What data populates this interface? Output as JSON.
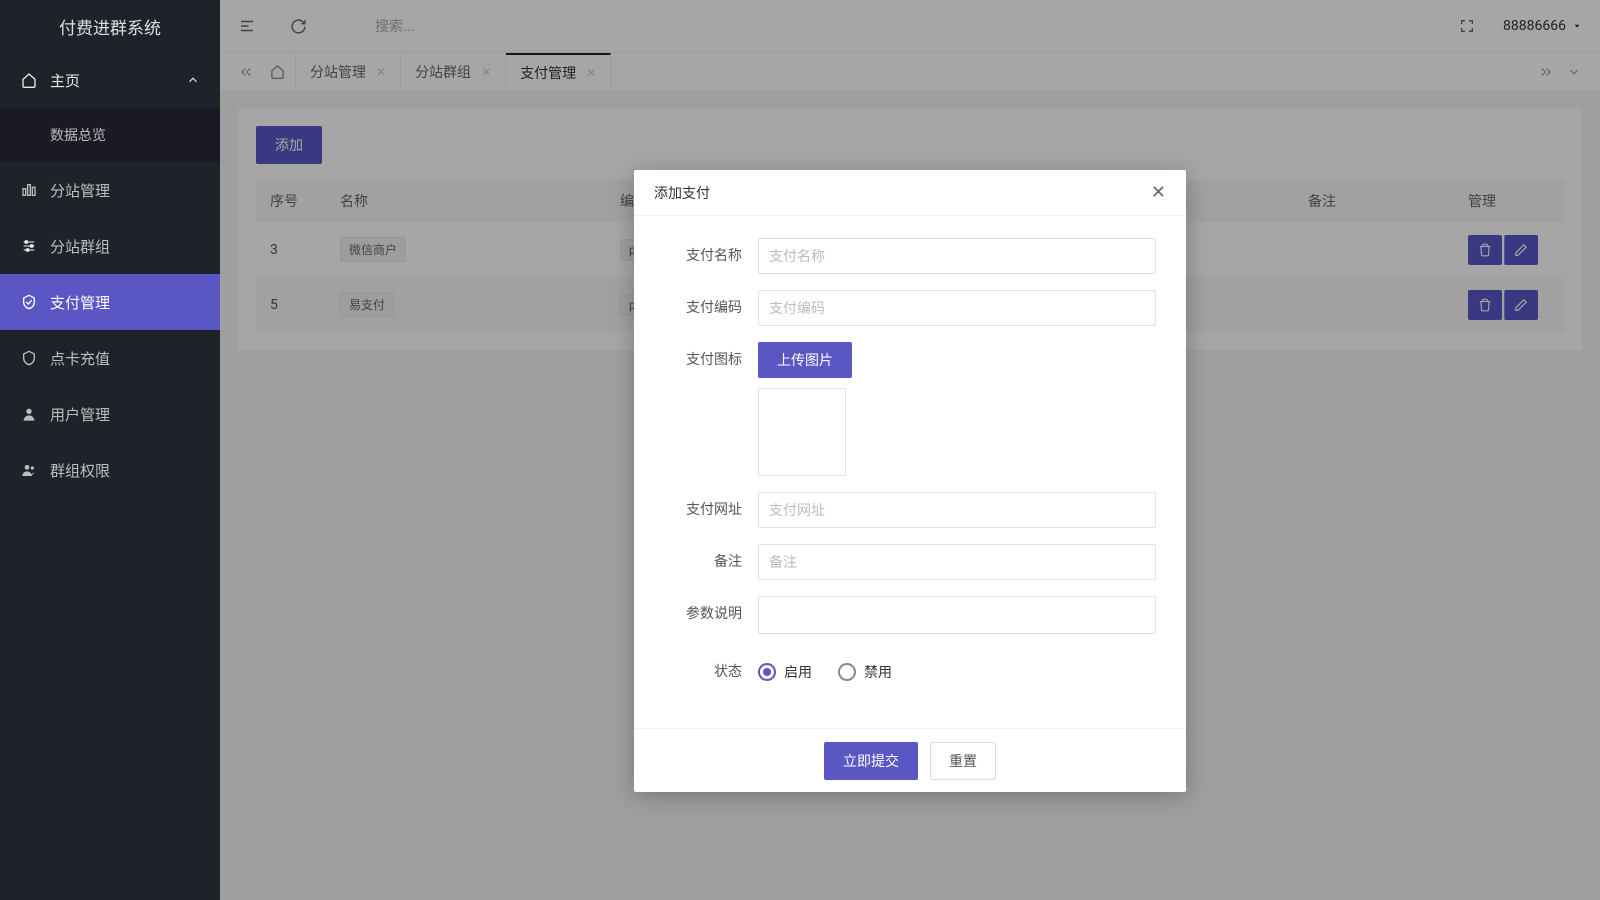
{
  "app": {
    "title": "付费进群系统"
  },
  "header": {
    "search_placeholder": "搜索...",
    "username": "88886666"
  },
  "sidebar": {
    "home_label": "主页",
    "sub_dashboard": "数据总览",
    "items": [
      {
        "label": "分站管理"
      },
      {
        "label": "分站群组"
      },
      {
        "label": "支付管理"
      },
      {
        "label": "点卡充值"
      },
      {
        "label": "用户管理"
      },
      {
        "label": "群组权限"
      }
    ]
  },
  "tabs": {
    "items": [
      {
        "label": "分站管理"
      },
      {
        "label": "分站群组"
      },
      {
        "label": "支付管理"
      }
    ]
  },
  "page": {
    "add_button": "添加",
    "columns": {
      "seq": "序号",
      "name": "名称",
      "code": "编码",
      "remark": "备注",
      "manage": "管理"
    },
    "rows": [
      {
        "seq": "3",
        "name": "微信商户",
        "code": "payv"
      },
      {
        "seq": "5",
        "name": "易支付",
        "code": "pay"
      }
    ]
  },
  "modal": {
    "title": "添加支付",
    "labels": {
      "name": "支付名称",
      "code": "支付编码",
      "icon": "支付图标",
      "url": "支付网址",
      "remark": "备注",
      "params": "参数说明",
      "status": "状态"
    },
    "placeholders": {
      "name": "支付名称",
      "code": "支付编码",
      "url": "支付网址",
      "remark": "备注"
    },
    "upload_button": "上传图片",
    "status_options": {
      "enabled": "启用",
      "disabled": "禁用"
    },
    "submit": "立即提交",
    "reset": "重置"
  }
}
